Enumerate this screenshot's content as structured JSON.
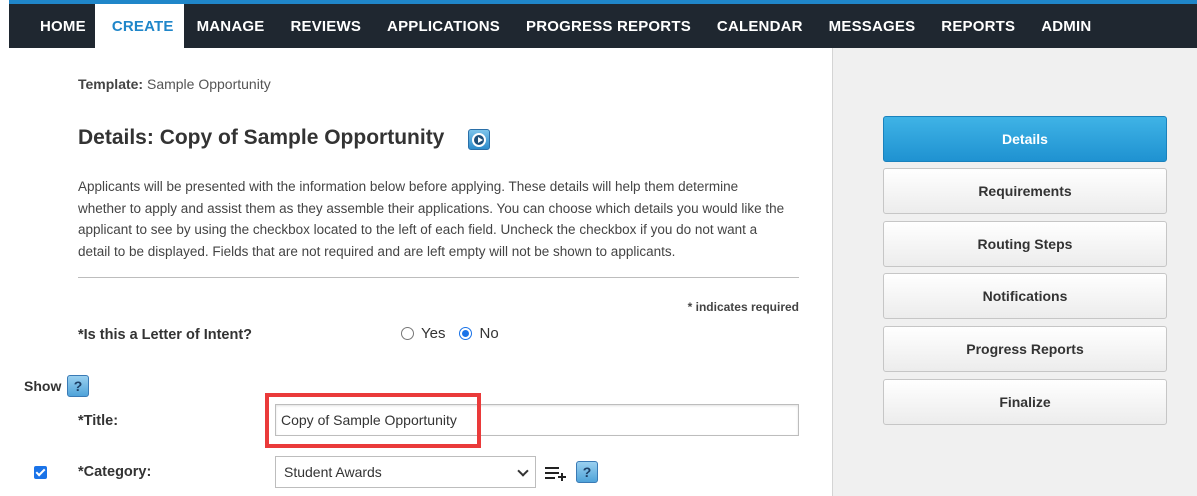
{
  "nav": {
    "items": [
      {
        "label": "HOME",
        "active": false
      },
      {
        "label": "CREATE",
        "active": true
      },
      {
        "label": "MANAGE",
        "active": false
      },
      {
        "label": "REVIEWS",
        "active": false
      },
      {
        "label": "APPLICATIONS",
        "active": false
      },
      {
        "label": "PROGRESS REPORTS",
        "active": false
      },
      {
        "label": "CALENDAR",
        "active": false
      },
      {
        "label": "MESSAGES",
        "active": false
      },
      {
        "label": "REPORTS",
        "active": false
      },
      {
        "label": "ADMIN",
        "active": false
      }
    ]
  },
  "template": {
    "label": "Template:",
    "value": "Sample Opportunity"
  },
  "page": {
    "title": "Details: Copy of Sample Opportunity",
    "video_icon": "play-circle-icon",
    "description": "Applicants will be presented with the information below before applying. These details will help them determine whether to apply and assist them as they assemble their applications. You can choose which details you would like the applicant to see by using the checkbox located to the left of each field. Uncheck the checkbox if you do not want a detail to be displayed. Fields that are not required and are left empty will not be shown to applicants.",
    "required_note": "* indicates required"
  },
  "form": {
    "loi": {
      "label": "*Is this a Letter of Intent?",
      "options": [
        "Yes",
        "No"
      ],
      "selected": "No"
    },
    "show_label": "Show",
    "help_glyph": "?",
    "title": {
      "label": "*Title:",
      "value": "Copy of Sample Opportunity"
    },
    "category": {
      "label": "*Category:",
      "value": "Student Awards",
      "shown": true,
      "add_icon": "list-add-icon"
    }
  },
  "sidebar": {
    "items": [
      {
        "label": "Details",
        "active": true
      },
      {
        "label": "Requirements",
        "active": false
      },
      {
        "label": "Routing Steps",
        "active": false
      },
      {
        "label": "Notifications",
        "active": false
      },
      {
        "label": "Progress Reports",
        "active": false
      },
      {
        "label": "Finalize",
        "active": false
      }
    ]
  },
  "colors": {
    "nav_bg": "#1f2730",
    "accent": "#1f86c9",
    "highlight": "#ea3a3a"
  }
}
